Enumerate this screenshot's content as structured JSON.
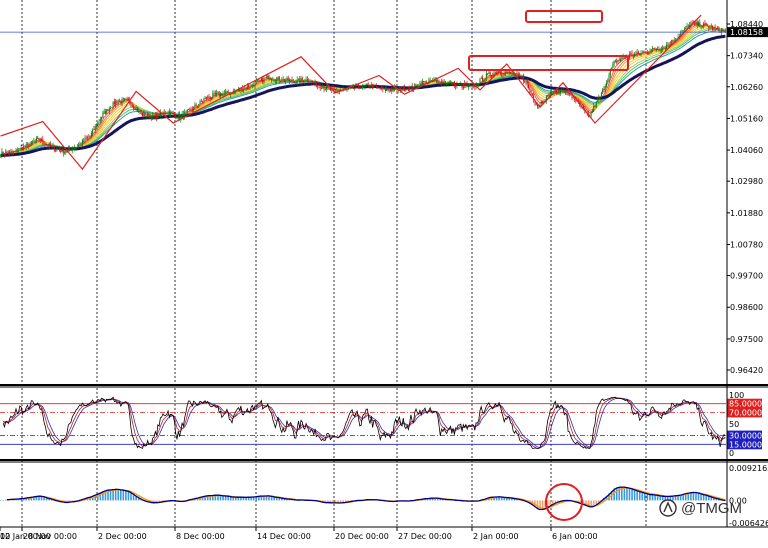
{
  "colors": {
    "background": "#ffffff",
    "bull_candle": "#0b7a0b",
    "bear_candle": "#c81515",
    "slow_ma": "#14145a",
    "zigzag": "#e02020",
    "annotation": "#e02020",
    "bid_line": "#3050c8",
    "grid": "#000000",
    "rsi_fast": "#000000",
    "rsi_mid": "#c02020",
    "rsi_slow": "#3030c0",
    "level_upper": "#e02020",
    "level_lower": "#2020c0",
    "macd_hist_pos": "#3a9ae0",
    "macd_hist_neg": "#f4a070",
    "macd_signal": "#ff9800",
    "macd_line": "#000080",
    "ribbon": [
      "#ef5350",
      "#ff7043",
      "#ffa726",
      "#ffca28",
      "#d4e157",
      "#9ccc65",
      "#66bb6a",
      "#26a69a"
    ]
  },
  "chart_data": [
    {
      "type": "candlestick",
      "panel": "price",
      "ylim": [
        0.9595,
        1.0908
      ],
      "y_tick_labels": [
        "1.08440",
        "1.07340",
        "1.06260",
        "1.05160",
        "1.04060",
        "1.02980",
        "1.01880",
        "1.00780",
        "0.99700",
        "0.98600",
        "0.97500",
        "0.96420"
      ],
      "current_price_label": "1.08158",
      "current_price": 1.08158,
      "x_tick_labels": [
        "00",
        "28 Nov 00:00",
        "2 Dec 00:00",
        "8 Dec 00:00",
        "14 Dec 00:00",
        "20 Dec 00:00",
        "27 Dec 00:00",
        "2 Jan 00:00",
        "6 Jan 00:00",
        "12 Jan 00:00"
      ],
      "close_anchors": [
        [
          0,
          1.0395
        ],
        [
          10,
          1.0398
        ],
        [
          20,
          1.042
        ],
        [
          30,
          1.0445
        ],
        [
          40,
          1.0415
        ],
        [
          50,
          1.04
        ],
        [
          60,
          1.042
        ],
        [
          70,
          1.0455
        ],
        [
          80,
          1.053
        ],
        [
          90,
          1.0575
        ],
        [
          100,
          1.0578
        ],
        [
          110,
          1.053
        ],
        [
          120,
          1.052
        ],
        [
          130,
          1.054
        ],
        [
          140,
          1.052
        ],
        [
          150,
          1.055
        ],
        [
          160,
          1.0585
        ],
        [
          170,
          1.06
        ],
        [
          180,
          1.0605
        ],
        [
          190,
          1.062
        ],
        [
          200,
          1.064
        ],
        [
          210,
          1.066
        ],
        [
          220,
          1.065
        ],
        [
          230,
          1.0645
        ],
        [
          240,
          1.065
        ],
        [
          250,
          1.063
        ],
        [
          260,
          1.061
        ],
        [
          270,
          1.0615
        ],
        [
          280,
          1.0625
        ],
        [
          290,
          1.063
        ],
        [
          300,
          1.0615
        ],
        [
          310,
          1.0618
        ],
        [
          320,
          1.062
        ],
        [
          330,
          1.064
        ],
        [
          340,
          1.0645
        ],
        [
          350,
          1.064
        ],
        [
          360,
          1.063
        ],
        [
          370,
          1.0625
        ],
        [
          380,
          1.0665
        ],
        [
          390,
          1.068
        ],
        [
          400,
          1.067
        ],
        [
          410,
          1.065
        ],
        [
          420,
          1.056
        ],
        [
          430,
          1.06
        ],
        [
          440,
          1.0615
        ],
        [
          450,
          1.058
        ],
        [
          460,
          1.052
        ],
        [
          470,
          1.06
        ],
        [
          480,
          1.071
        ],
        [
          490,
          1.0735
        ],
        [
          500,
          1.074
        ],
        [
          510,
          1.0755
        ],
        [
          520,
          1.0765
        ],
        [
          530,
          1.08
        ],
        [
          540,
          1.0845
        ],
        [
          550,
          1.084
        ],
        [
          560,
          1.0825
        ],
        [
          567,
          1.0816
        ]
      ],
      "zigzag_pivots": [
        [
          0,
          1.0455
        ],
        [
          33,
          1.0505
        ],
        [
          64,
          1.034
        ],
        [
          106,
          1.061
        ],
        [
          135,
          1.05
        ],
        [
          235,
          1.073
        ],
        [
          262,
          1.0605
        ],
        [
          296,
          1.0665
        ],
        [
          316,
          1.06
        ],
        [
          358,
          1.069
        ],
        [
          375,
          1.0615
        ],
        [
          396,
          1.0705
        ],
        [
          422,
          1.0555
        ],
        [
          440,
          1.064
        ],
        [
          465,
          1.05
        ],
        [
          548,
          1.0875
        ]
      ],
      "annotations": [
        "box around recent highs",
        "box around breakout zone"
      ]
    },
    {
      "type": "line",
      "panel": "oscillator",
      "ylim": [
        0,
        100
      ],
      "y_tick_labels": [
        "100",
        "50",
        "0"
      ],
      "levels": [
        {
          "label": "85.0000",
          "value": 85
        },
        {
          "label": "70.0000",
          "value": 70
        },
        {
          "label": "30.0000",
          "value": 30
        },
        {
          "label": "15.0000",
          "value": 15
        }
      ]
    },
    {
      "type": "bar",
      "panel": "macd",
      "ylim": [
        -0.0064263,
        0.0092163
      ],
      "y_tick_labels": [
        "0.0092163",
        "0.00",
        "-0.0064263"
      ],
      "annotations": [
        "circle around latest histogram bars"
      ]
    }
  ],
  "watermark": {
    "text": "@TMGM"
  }
}
